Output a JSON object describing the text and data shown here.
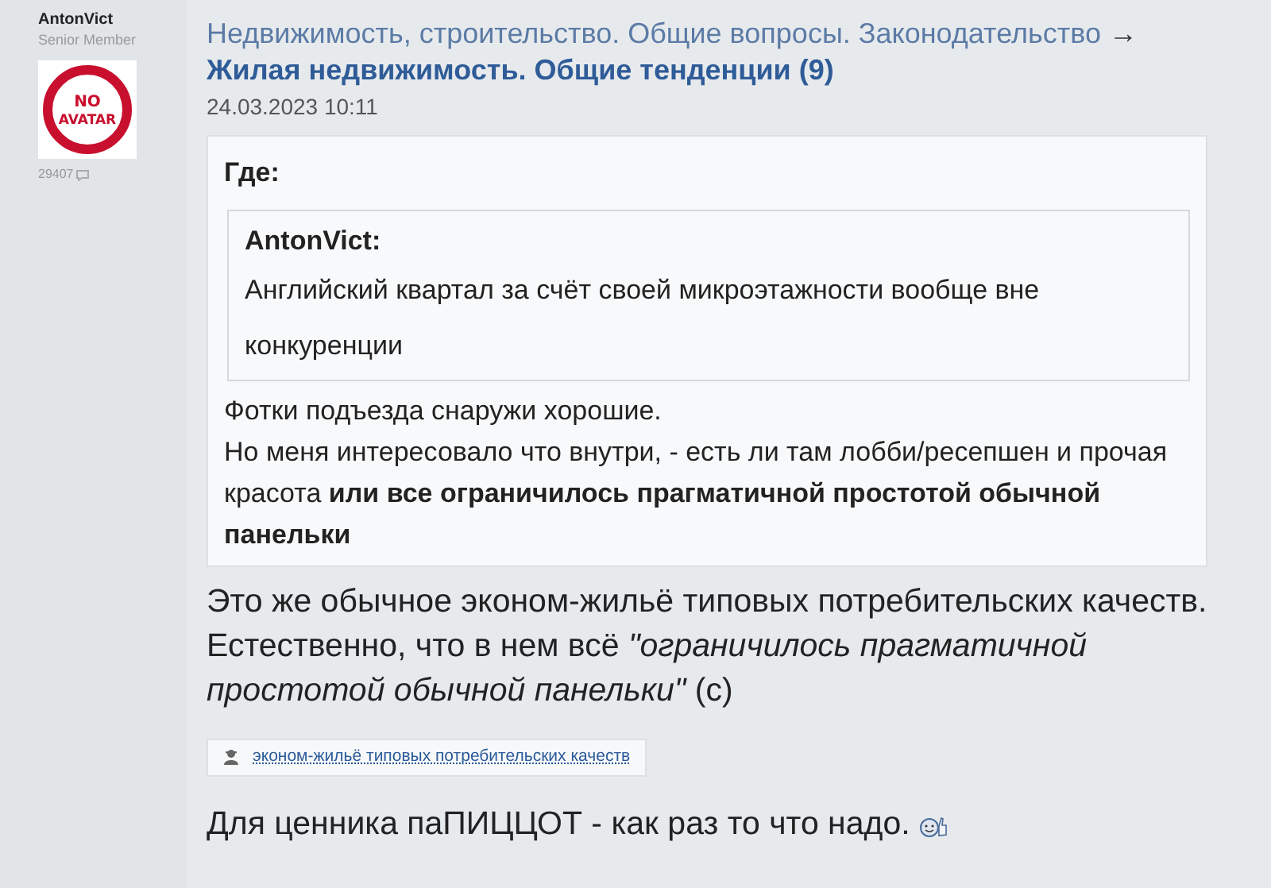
{
  "author": {
    "name": "AntonVict",
    "rank": "Senior Member",
    "avatar_text": [
      "NO",
      "AVATAR"
    ],
    "post_count": "29407"
  },
  "breadcrumb": {
    "section": "Недвижимость, строительство. Общие вопросы. Законодательство",
    "arrow": "→"
  },
  "topic": {
    "title": "Жилая недвижимость. Общие тенденции (9)"
  },
  "date": "24.03.2023 10:11",
  "quote": {
    "author": "Где:",
    "nested": {
      "author": "AntonVict:",
      "text": "Английский квартал за счёт своей микроэтажности вообще вне конкуренции"
    },
    "lines": [
      "Фотки подъезда снаружи хорошие.",
      "Но меня интересовало что внутри, - есть ли там лобби/ресепшен и прочая красота **или все ограничилось прагматичной простотой обычной панельки**"
    ]
  },
  "reply": "Это же обычное эконом-жильё типовых потребительских качеств. Естественно, что в нем всё *\"ограничилось прагматичной простотой обычной панельки\"* (с)",
  "tag_link": "эконом-жильё типовых потребительских качеств",
  "closing": "Для ценника паПИЦЦОТ - как раз то что надо."
}
